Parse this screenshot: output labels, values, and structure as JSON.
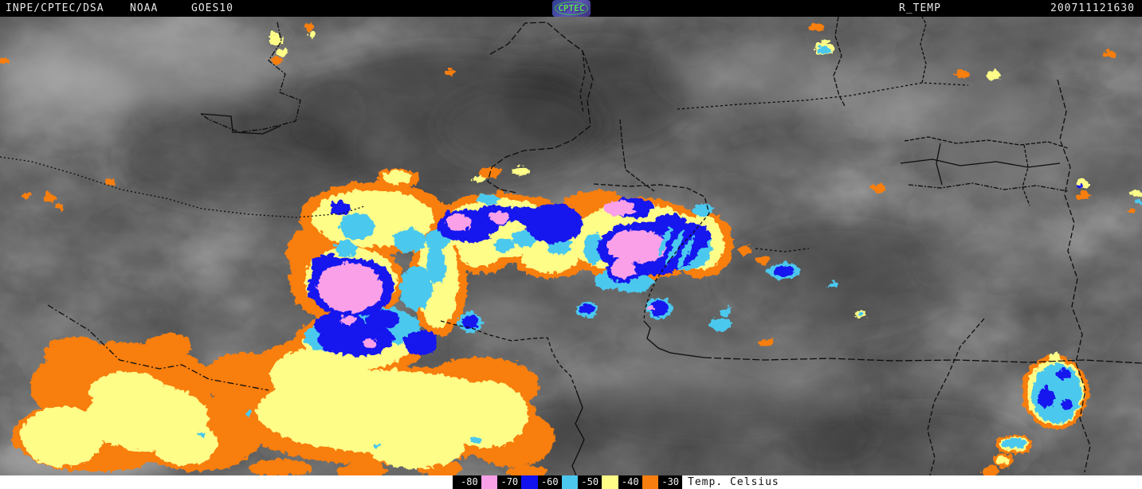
{
  "header": {
    "agency": "INPE/CPTEC/DSA",
    "noaa": "NOAA",
    "satellite": "GOES10",
    "logo_text": "CPTEC",
    "product": "R_TEMP",
    "timestamp": "200711121630"
  },
  "legend": {
    "title": "Temp. Celsius",
    "entries": [
      {
        "label": "-80",
        "swatch": "#f9a0e8"
      },
      {
        "label": "-70",
        "swatch": "#1212ee"
      },
      {
        "label": "-60",
        "swatch": "#4cc8ee"
      },
      {
        "label": "-50",
        "swatch": "#fdfd88"
      },
      {
        "label": "-40",
        "swatch": "#f87e10"
      },
      {
        "label": "-30",
        "swatch": null
      }
    ]
  },
  "palette": {
    "pink": "#f9a0e8",
    "blue": "#1212ee",
    "cyan": "#4cc8ee",
    "yellow": "#fdfd88",
    "orange": "#f87e10",
    "header_bg": "#000000",
    "footer_bg": "#ffffff",
    "border_line": "#0d0d0d"
  }
}
